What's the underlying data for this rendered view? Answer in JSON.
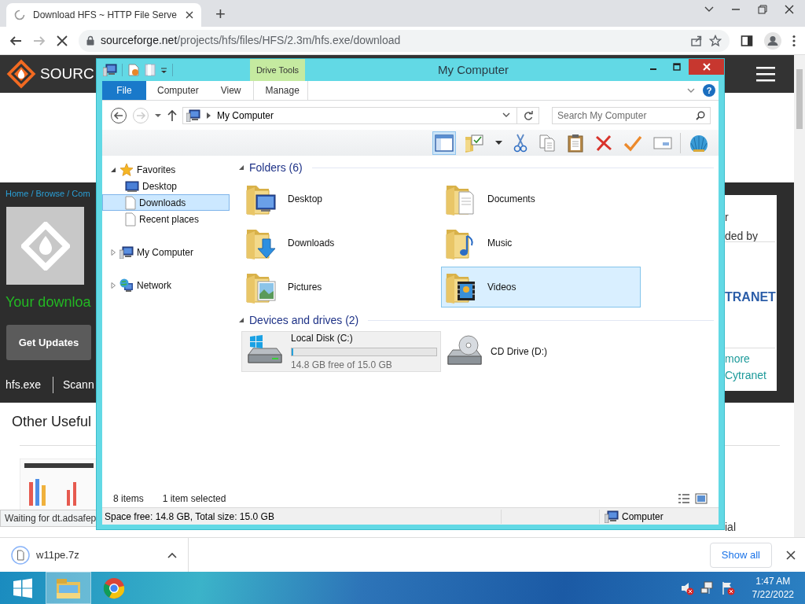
{
  "browser": {
    "tab": {
      "title": "Download HFS ~ HTTP File Serve",
      "loading": true
    },
    "new_tab": "+",
    "forward_disabled": true,
    "url": {
      "host": "sourceforge.net",
      "path": "/projects/hfs/files/HFS/2.3m/hfs.exe/download"
    }
  },
  "web_page": {
    "logo_text": "SOURC",
    "breadcrumb": "Home / Browse / Com",
    "headline": "Your downloa",
    "update_button": "Get Updates",
    "file_name": "hfs.exe",
    "scan_text": "Scann",
    "section_title": "Other Useful",
    "sidebar_texts": [
      "r",
      "ded by"
    ],
    "sponsor_logo": "TRANET",
    "sidebar_links": [
      "more",
      "Cytranet"
    ],
    "bottom_text": "ial",
    "status_text": "Waiting for dt.adsafep"
  },
  "explorer": {
    "title": "My Computer",
    "context_tab": "Drive Tools",
    "tabs": [
      {
        "label": "File",
        "kind": "file"
      },
      {
        "label": "Computer",
        "kind": "tab"
      },
      {
        "label": "View",
        "kind": "tab"
      },
      {
        "label": "Manage",
        "kind": "context"
      }
    ],
    "help": "?",
    "address": "My Computer",
    "search": {
      "placeholder": "Search My Computer"
    },
    "preview_pane": {
      "on": true
    },
    "tools": [
      {
        "kind": "preview-pane"
      },
      {
        "kind": "folder-options"
      },
      {
        "kind": "dropdown"
      },
      {
        "kind": "cut"
      },
      {
        "kind": "copy"
      },
      {
        "kind": "paste"
      },
      {
        "kind": "delete"
      },
      {
        "kind": "check"
      },
      {
        "kind": "properties"
      },
      {
        "kind": "separator"
      },
      {
        "kind": "shell"
      }
    ],
    "nav": [
      {
        "label": "Favorites",
        "kind": "star",
        "expanded": true,
        "children": [
          {
            "label": "Desktop",
            "kind": "desktop",
            "selected": false
          },
          {
            "label": "Downloads",
            "kind": "page",
            "selected": true
          },
          {
            "label": "Recent places",
            "kind": "page",
            "selected": false
          }
        ]
      },
      {
        "label": "My Computer",
        "kind": "computer",
        "expanded": false
      },
      {
        "label": "Network",
        "kind": "network",
        "expanded": false
      }
    ],
    "groups": [
      {
        "title": "Folders (6)",
        "expanded": true,
        "items": [
          {
            "name": "Desktop",
            "kind": "desktop",
            "selected": false
          },
          {
            "name": "Documents",
            "kind": "documents",
            "selected": false
          },
          {
            "name": "Downloads",
            "kind": "downloads",
            "selected": false
          },
          {
            "name": "Music",
            "kind": "music",
            "selected": false
          },
          {
            "name": "Pictures",
            "kind": "pictures",
            "selected": false
          },
          {
            "name": "Videos",
            "kind": "videos",
            "selected": true
          }
        ]
      },
      {
        "title": "Devices and drives (2)",
        "expanded": true,
        "items": [
          {
            "name": "Local Disk (C:)",
            "kind": "disk",
            "selected": false,
            "focused": true,
            "level": 0.013,
            "detail": "14.8 GB free of 15.0 GB"
          },
          {
            "name": "CD Drive (D:)",
            "kind": "cd",
            "selected": false,
            "focused": false
          }
        ]
      }
    ],
    "item_count": "8 items",
    "selection_count": "1 item selected",
    "status_bar": {
      "space": "Space free: 14.8 GB, Total size: 15.0 GB",
      "location": "Computer"
    }
  },
  "download_bar": {
    "file": "w11pe.7z",
    "show_all": "Show all"
  },
  "taskbar": {
    "apps": [
      {
        "kind": "explorer",
        "active": true
      },
      {
        "kind": "browser",
        "active": false
      }
    ],
    "time": "1:47 AM",
    "date": "7/22/2022"
  }
}
